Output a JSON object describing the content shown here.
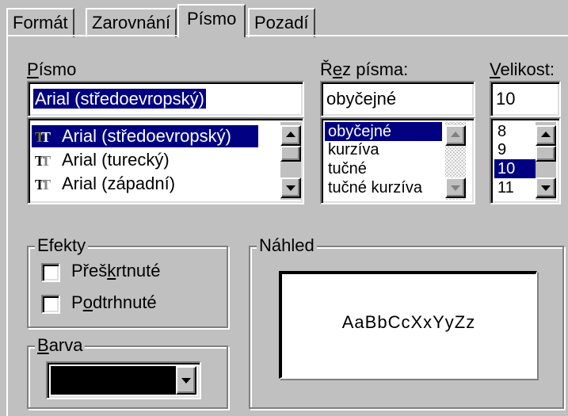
{
  "tabs": [
    {
      "label": "Formát"
    },
    {
      "label": "Zarovnání"
    },
    {
      "label": "Písmo"
    },
    {
      "label": "Pozadí"
    }
  ],
  "font": {
    "label_key": "P",
    "label_rest": "ísmo",
    "value": "Arial (středoevropský)",
    "list": [
      {
        "label": "Arial (středoevropský)"
      },
      {
        "label": "Arial (turecký)"
      },
      {
        "label": "Arial (západní)"
      }
    ]
  },
  "style": {
    "label_pre": "Ř",
    "label_key": "e",
    "label_rest": "z písma:",
    "value": "obyčejné",
    "list": [
      {
        "label": "obyčejné"
      },
      {
        "label": "kurzíva"
      },
      {
        "label": "tučné"
      },
      {
        "label": "tučné kurzíva"
      }
    ]
  },
  "size": {
    "label_key": "V",
    "label_rest": "elikost:",
    "value": "10",
    "list": [
      {
        "label": "8"
      },
      {
        "label": "9"
      },
      {
        "label": "10"
      },
      {
        "label": "11"
      }
    ]
  },
  "effects": {
    "title": "Efekty",
    "strikethrough": {
      "pre": "Přeš",
      "key": "k",
      "rest": "rtnuté",
      "checked": false
    },
    "underline": {
      "pre": "P",
      "key": "o",
      "rest": "dtrhnuté",
      "checked": false
    }
  },
  "color": {
    "label_key": "B",
    "label_rest": "arva",
    "value_color": "#000000"
  },
  "preview": {
    "title": "Náhled",
    "sample_text": "AaBbCcXxYyZz"
  },
  "colors": {
    "face": "#c0c0c0",
    "selection": "#000080",
    "truetype_icon": "#000000"
  },
  "icons": [
    "truetype-icon",
    "scroll-up-arrow",
    "scroll-down-arrow",
    "dropdown-arrow"
  ]
}
